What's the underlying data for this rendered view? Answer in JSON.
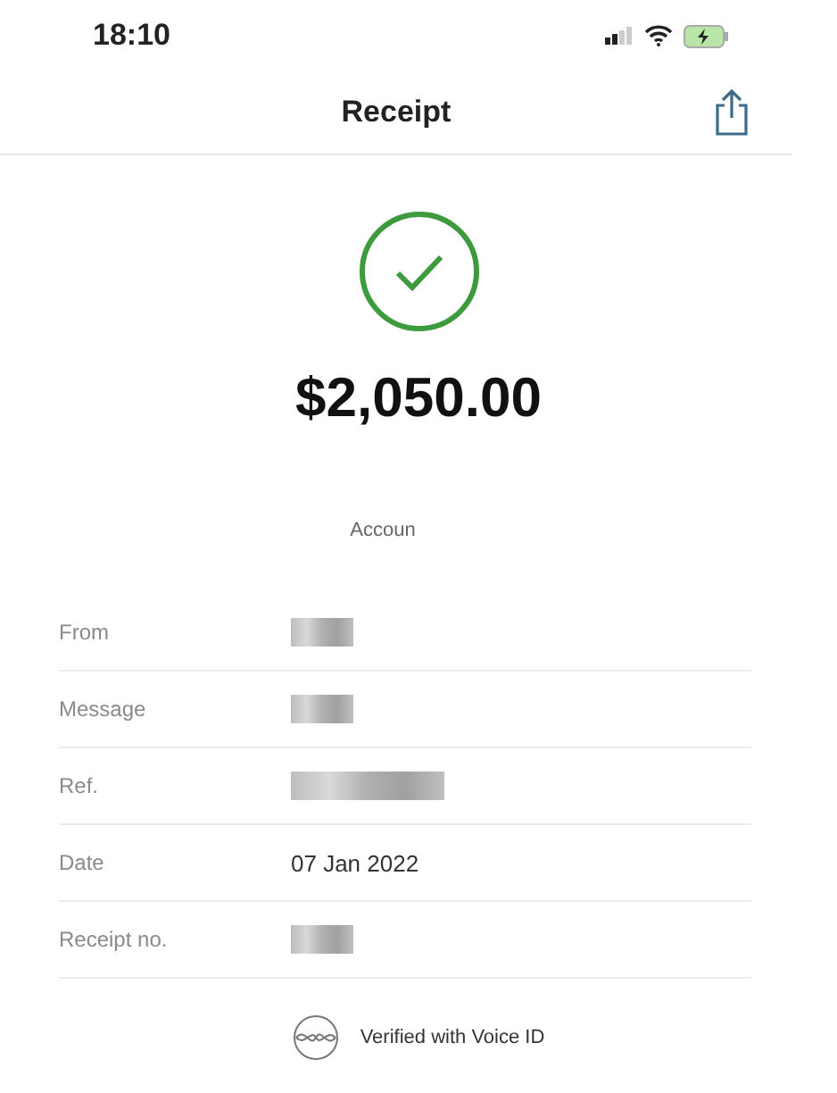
{
  "status_bar": {
    "time": "18:10",
    "battery_charging": true
  },
  "nav": {
    "title": "Receipt"
  },
  "receipt": {
    "success": true,
    "amount": "$2,050.00",
    "account_label": "Accoun"
  },
  "rows": [
    {
      "label": "From",
      "kind": "redacted"
    },
    {
      "label": "Message",
      "kind": "redacted"
    },
    {
      "label": "Ref.",
      "kind": "redacted"
    },
    {
      "label": "Date",
      "kind": "text",
      "value": "07 Jan 2022"
    },
    {
      "label": "Receipt no.",
      "kind": "redacted"
    }
  ],
  "footer": {
    "verified": "Verified with Voice ID"
  }
}
